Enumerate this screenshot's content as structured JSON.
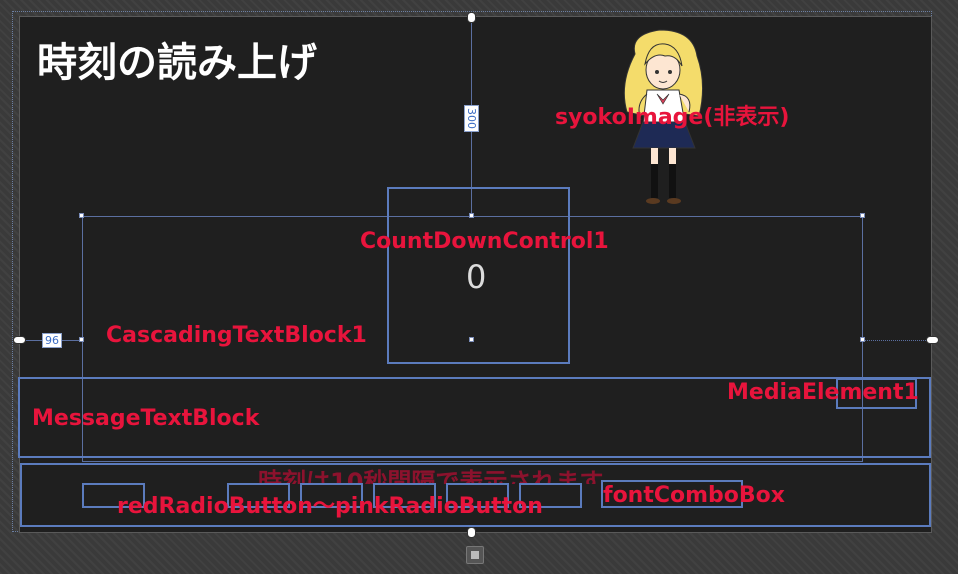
{
  "title": "時刻の読み上げ",
  "labels": {
    "syoko_image": "syokoImage(非表示)",
    "countdown": "CountDownControl1",
    "countdown_value": "0",
    "cascading": "CascadingTextBlock1",
    "media": "MediaElement1",
    "message": "MessageTextBlock",
    "radio_range": "redRadioButton～pinkRadioButton",
    "font_combo": "fontComboBox",
    "hidden_text": "時刻は10秒間隔で表示されます"
  },
  "dimensions": {
    "top_margin": "300",
    "left_margin": "96"
  },
  "colors": {
    "canvas": "#1f1f1f",
    "label_red": "#e8143c",
    "outline_blue": "#5b7bbd"
  }
}
